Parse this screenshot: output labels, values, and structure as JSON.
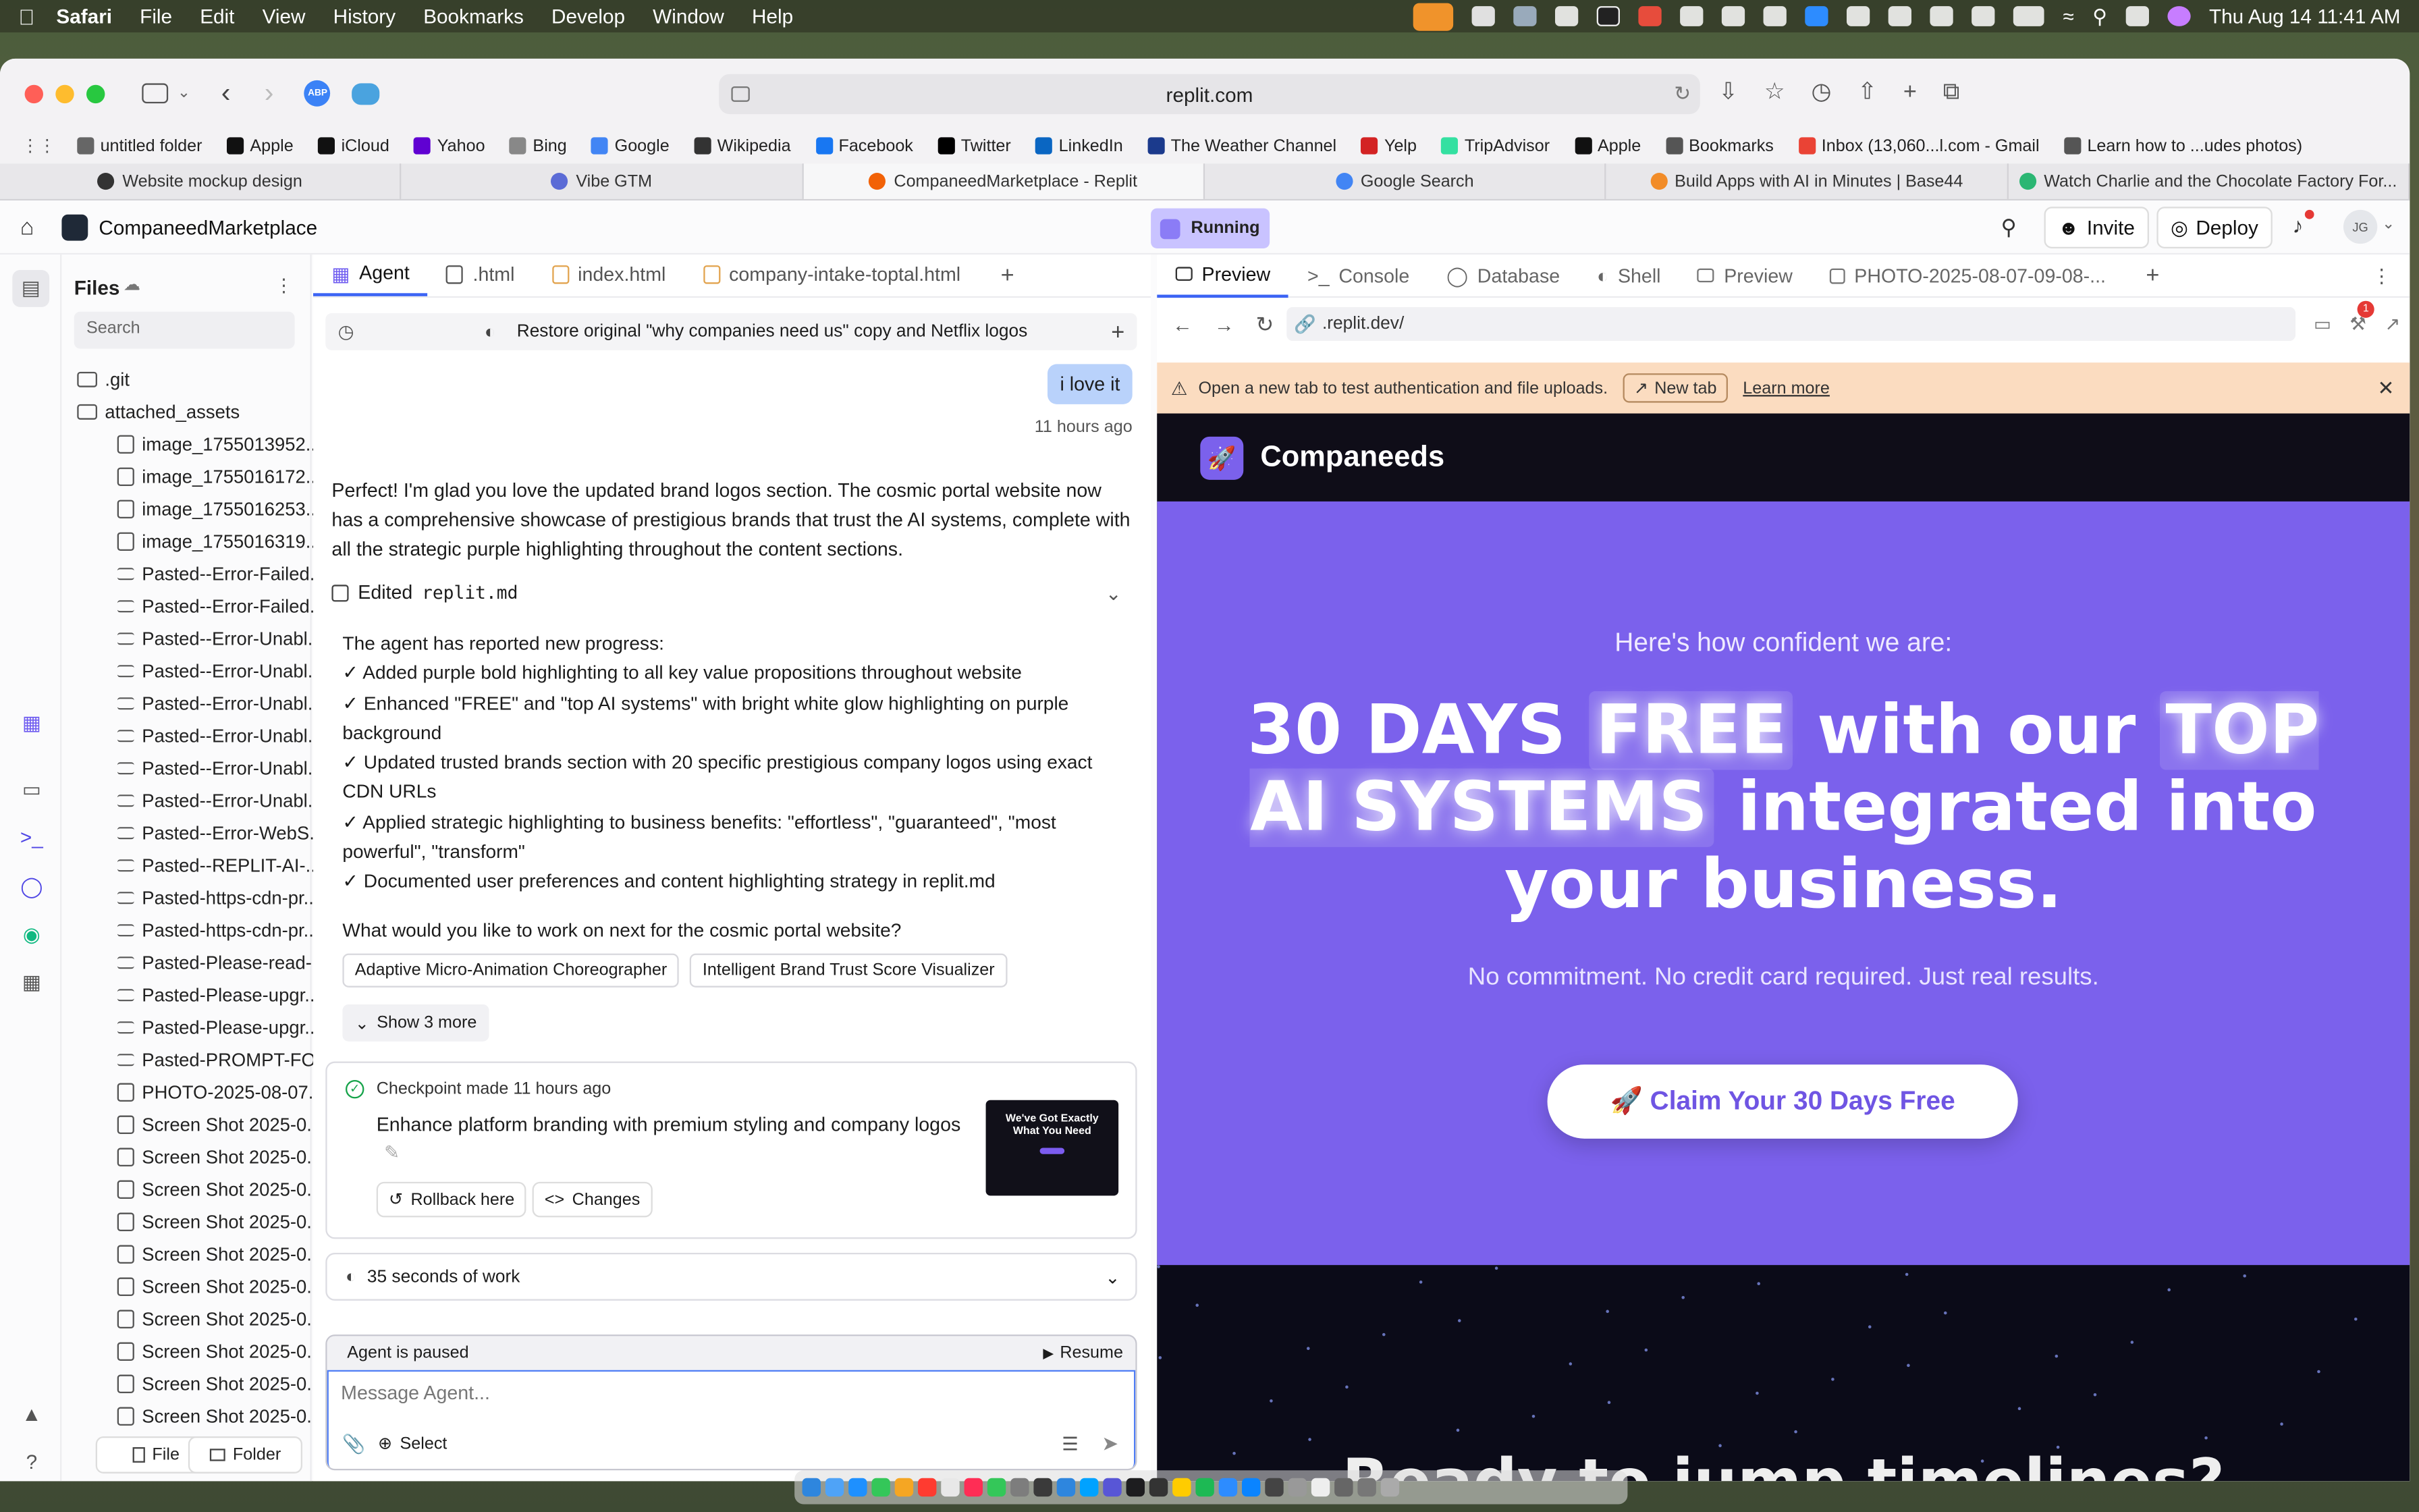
{
  "menubar": {
    "app": "Safari",
    "items": [
      "File",
      "Edit",
      "View",
      "History",
      "Bookmarks",
      "Develop",
      "Window",
      "Help"
    ],
    "clock": "Thu Aug 14  11:41 AM"
  },
  "browser": {
    "url": "replit.com",
    "favorites": [
      {
        "label": "untitled folder",
        "icon": "folder-icon",
        "color": "#666666"
      },
      {
        "label": "Apple",
        "icon": "apple-icon",
        "color": "#111111"
      },
      {
        "label": "iCloud",
        "icon": "apple-icon",
        "color": "#111111"
      },
      {
        "label": "Yahoo",
        "icon": "yahoo-icon",
        "color": "#6001d2"
      },
      {
        "label": "Bing",
        "icon": "bing-icon",
        "color": "#888888"
      },
      {
        "label": "Google",
        "icon": "google-icon",
        "color": "#4285f4"
      },
      {
        "label": "Wikipedia",
        "icon": "wikipedia-icon",
        "color": "#333333"
      },
      {
        "label": "Facebook",
        "icon": "facebook-icon",
        "color": "#1877f2"
      },
      {
        "label": "Twitter",
        "icon": "x-icon",
        "color": "#000000"
      },
      {
        "label": "LinkedIn",
        "icon": "linkedin-icon",
        "color": "#0a66c2"
      },
      {
        "label": "The Weather Channel",
        "icon": "weather-icon",
        "color": "#1b3a8c"
      },
      {
        "label": "Yelp",
        "icon": "yelp-icon",
        "color": "#d32323"
      },
      {
        "label": "TripAdvisor",
        "icon": "tripadvisor-icon",
        "color": "#34e0a1"
      },
      {
        "label": "Apple",
        "icon": "apple-icon",
        "color": "#111111"
      },
      {
        "label": "Bookmarks",
        "icon": "globe-icon",
        "color": "#555555"
      },
      {
        "label": "Inbox (13,060...l.com - Gmail",
        "icon": "google-icon",
        "color": "#ea4335"
      },
      {
        "label": "Learn how to ...udes photos)",
        "icon": "globe-icon",
        "color": "#555555"
      }
    ],
    "tabs": [
      {
        "label": "Website mockup design",
        "icon": "openai-icon",
        "color": "#333333",
        "active": false
      },
      {
        "label": "Vibe GTM",
        "icon": "vibe-icon",
        "color": "#5b6bd6",
        "active": false
      },
      {
        "label": "CompaneedMarketplace - Replit",
        "icon": "replit-icon",
        "color": "#f26207",
        "active": true
      },
      {
        "label": "Google Search",
        "icon": "google-icon",
        "color": "#4285f4",
        "active": false
      },
      {
        "label": "Build Apps with AI in Minutes | Base44",
        "icon": "base44-icon",
        "color": "#f28c28",
        "active": false
      },
      {
        "label": "Watch Charlie and the Chocolate Factory For...",
        "icon": "play-icon",
        "color": "#2bb673",
        "active": false
      }
    ]
  },
  "replit": {
    "project_name": "CompaneedMarketplace",
    "status": "Running",
    "invite_label": "Invite",
    "deploy_label": "Deploy",
    "avatar_initials": "JG",
    "files": {
      "title": "Files",
      "search_placeholder": "Search",
      "folders": [
        ".git",
        "attached_assets"
      ],
      "items": [
        {
          "name": "image_1755013952...",
          "type": "image"
        },
        {
          "name": "image_1755016172...",
          "type": "image"
        },
        {
          "name": "image_1755016253...",
          "type": "image"
        },
        {
          "name": "image_1755016319...",
          "type": "image"
        },
        {
          "name": "Pasted--Error-Failed...",
          "type": "text"
        },
        {
          "name": "Pasted--Error-Failed...",
          "type": "text"
        },
        {
          "name": "Pasted--Error-Unabl...",
          "type": "text"
        },
        {
          "name": "Pasted--Error-Unabl...",
          "type": "text"
        },
        {
          "name": "Pasted--Error-Unabl...",
          "type": "text"
        },
        {
          "name": "Pasted--Error-Unabl...",
          "type": "text"
        },
        {
          "name": "Pasted--Error-Unabl...",
          "type": "text"
        },
        {
          "name": "Pasted--Error-Unabl...",
          "type": "text"
        },
        {
          "name": "Pasted--Error-WebS...",
          "type": "text"
        },
        {
          "name": "Pasted--REPLIT-AI-...",
          "type": "text"
        },
        {
          "name": "Pasted-https-cdn-pr...",
          "type": "text"
        },
        {
          "name": "Pasted-https-cdn-pr...",
          "type": "text"
        },
        {
          "name": "Pasted-Please-read-...",
          "type": "text"
        },
        {
          "name": "Pasted-Please-upgr...",
          "type": "text"
        },
        {
          "name": "Pasted-Please-upgr...",
          "type": "text"
        },
        {
          "name": "Pasted-PROMPT-FO...",
          "type": "text"
        },
        {
          "name": "PHOTO-2025-08-07...",
          "type": "image"
        },
        {
          "name": "Screen Shot 2025-0...",
          "type": "image"
        },
        {
          "name": "Screen Shot 2025-0...",
          "type": "image"
        },
        {
          "name": "Screen Shot 2025-0...",
          "type": "image"
        },
        {
          "name": "Screen Shot 2025-0...",
          "type": "image"
        },
        {
          "name": "Screen Shot 2025-0...",
          "type": "image"
        },
        {
          "name": "Screen Shot 2025-0...",
          "type": "image"
        },
        {
          "name": "Screen Shot 2025-0...",
          "type": "image"
        },
        {
          "name": "Screen Shot 2025-0...",
          "type": "image"
        },
        {
          "name": "Screen Shot 2025-0...",
          "type": "image"
        },
        {
          "name": "Screen Shot 2025-0...",
          "type": "image"
        }
      ],
      "new_file_label": "File",
      "new_folder_label": "Folder"
    },
    "editor_tabs": [
      "Agent",
      ".html",
      "index.html",
      "company-intake-toptal.html"
    ],
    "agent": {
      "history_title": "Restore original \"why companies need us\" copy and Netflix logos",
      "user_message": "i love it",
      "user_time": "11 hours ago",
      "reply": "Perfect! I'm glad you love the updated brand logos section. The cosmic portal website now has a comprehensive showcase of prestigious brands that trust the AI systems, complete with all the strategic purple highlighting throughout the content sections.",
      "edited_prefix": "Edited",
      "edited_file": "replit.md",
      "progress_intro": "The agent has reported new progress:",
      "progress": [
        "✓ Added purple bold highlighting to all key value propositions throughout website",
        "✓ Enhanced \"FREE\" and \"top AI systems\" with bright white glow highlighting on purple background",
        "✓ Updated trusted brands section with 20 specific prestigious company logos using exact CDN URLs",
        "✓ Applied strategic highlighting to business benefits: \"effortless\", \"guaranteed\", \"most powerful\", \"transform\"",
        "✓ Documented user preferences and content highlighting strategy in replit.md"
      ],
      "question": "What would you like to work on next for the cosmic portal website?",
      "suggestions": [
        "Adaptive Micro-Animation Choreographer",
        "Intelligent Brand Trust Score Visualizer"
      ],
      "show_more": "Show 3 more",
      "checkpoint_label": "Checkpoint made 11 hours ago",
      "checkpoint_title": "Enhance platform branding with premium styling and company logos",
      "rollback_label": "Rollback here",
      "changes_label": "Changes",
      "thumb_text": "We've Got Exactly What You Need",
      "work_label": "35 seconds of work",
      "paused_label": "Agent is paused",
      "resume_label": "Resume",
      "message_placeholder": "Message Agent...",
      "select_label": "Select"
    },
    "preview_tabs": [
      "Preview",
      "Console",
      "Database",
      "Shell",
      "Preview",
      "PHOTO-2025-08-07-09-08-..."
    ],
    "preview_url": ".replit.dev/",
    "notice": "Open a new tab to test authentication and file uploads.",
    "new_tab_label": "New tab",
    "learn_more_label": "Learn more",
    "notification_badge": "1",
    "site": {
      "brand": "Companeeds",
      "kicker": "Here's how confident we are:",
      "headline_a": "30 DAYS ",
      "headline_b": "FREE",
      "headline_c": " with our ",
      "headline_d": "TOP AI SYSTEMS",
      "headline_e": " integrated into your business.",
      "subline": "No commitment. No credit card required. Just real results.",
      "cta": "🚀 Claim Your 30 Days Free",
      "next_heading": "Ready to jump timelines?",
      "accent": "#7b61ec"
    }
  }
}
